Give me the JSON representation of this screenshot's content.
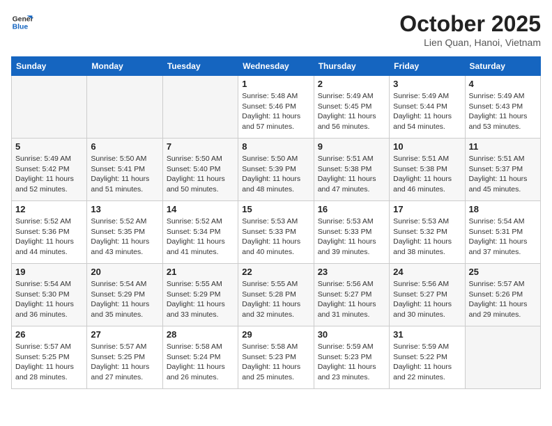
{
  "header": {
    "logo_line1": "General",
    "logo_line2": "Blue",
    "month": "October 2025",
    "location": "Lien Quan, Hanoi, Vietnam"
  },
  "days_of_week": [
    "Sunday",
    "Monday",
    "Tuesday",
    "Wednesday",
    "Thursday",
    "Friday",
    "Saturday"
  ],
  "weeks": [
    [
      {
        "day": "",
        "info": ""
      },
      {
        "day": "",
        "info": ""
      },
      {
        "day": "",
        "info": ""
      },
      {
        "day": "1",
        "info": "Sunrise: 5:48 AM\nSunset: 5:46 PM\nDaylight: 11 hours\nand 57 minutes."
      },
      {
        "day": "2",
        "info": "Sunrise: 5:49 AM\nSunset: 5:45 PM\nDaylight: 11 hours\nand 56 minutes."
      },
      {
        "day": "3",
        "info": "Sunrise: 5:49 AM\nSunset: 5:44 PM\nDaylight: 11 hours\nand 54 minutes."
      },
      {
        "day": "4",
        "info": "Sunrise: 5:49 AM\nSunset: 5:43 PM\nDaylight: 11 hours\nand 53 minutes."
      }
    ],
    [
      {
        "day": "5",
        "info": "Sunrise: 5:49 AM\nSunset: 5:42 PM\nDaylight: 11 hours\nand 52 minutes."
      },
      {
        "day": "6",
        "info": "Sunrise: 5:50 AM\nSunset: 5:41 PM\nDaylight: 11 hours\nand 51 minutes."
      },
      {
        "day": "7",
        "info": "Sunrise: 5:50 AM\nSunset: 5:40 PM\nDaylight: 11 hours\nand 50 minutes."
      },
      {
        "day": "8",
        "info": "Sunrise: 5:50 AM\nSunset: 5:39 PM\nDaylight: 11 hours\nand 48 minutes."
      },
      {
        "day": "9",
        "info": "Sunrise: 5:51 AM\nSunset: 5:38 PM\nDaylight: 11 hours\nand 47 minutes."
      },
      {
        "day": "10",
        "info": "Sunrise: 5:51 AM\nSunset: 5:38 PM\nDaylight: 11 hours\nand 46 minutes."
      },
      {
        "day": "11",
        "info": "Sunrise: 5:51 AM\nSunset: 5:37 PM\nDaylight: 11 hours\nand 45 minutes."
      }
    ],
    [
      {
        "day": "12",
        "info": "Sunrise: 5:52 AM\nSunset: 5:36 PM\nDaylight: 11 hours\nand 44 minutes."
      },
      {
        "day": "13",
        "info": "Sunrise: 5:52 AM\nSunset: 5:35 PM\nDaylight: 11 hours\nand 43 minutes."
      },
      {
        "day": "14",
        "info": "Sunrise: 5:52 AM\nSunset: 5:34 PM\nDaylight: 11 hours\nand 41 minutes."
      },
      {
        "day": "15",
        "info": "Sunrise: 5:53 AM\nSunset: 5:33 PM\nDaylight: 11 hours\nand 40 minutes."
      },
      {
        "day": "16",
        "info": "Sunrise: 5:53 AM\nSunset: 5:33 PM\nDaylight: 11 hours\nand 39 minutes."
      },
      {
        "day": "17",
        "info": "Sunrise: 5:53 AM\nSunset: 5:32 PM\nDaylight: 11 hours\nand 38 minutes."
      },
      {
        "day": "18",
        "info": "Sunrise: 5:54 AM\nSunset: 5:31 PM\nDaylight: 11 hours\nand 37 minutes."
      }
    ],
    [
      {
        "day": "19",
        "info": "Sunrise: 5:54 AM\nSunset: 5:30 PM\nDaylight: 11 hours\nand 36 minutes."
      },
      {
        "day": "20",
        "info": "Sunrise: 5:54 AM\nSunset: 5:29 PM\nDaylight: 11 hours\nand 35 minutes."
      },
      {
        "day": "21",
        "info": "Sunrise: 5:55 AM\nSunset: 5:29 PM\nDaylight: 11 hours\nand 33 minutes."
      },
      {
        "day": "22",
        "info": "Sunrise: 5:55 AM\nSunset: 5:28 PM\nDaylight: 11 hours\nand 32 minutes."
      },
      {
        "day": "23",
        "info": "Sunrise: 5:56 AM\nSunset: 5:27 PM\nDaylight: 11 hours\nand 31 minutes."
      },
      {
        "day": "24",
        "info": "Sunrise: 5:56 AM\nSunset: 5:27 PM\nDaylight: 11 hours\nand 30 minutes."
      },
      {
        "day": "25",
        "info": "Sunrise: 5:57 AM\nSunset: 5:26 PM\nDaylight: 11 hours\nand 29 minutes."
      }
    ],
    [
      {
        "day": "26",
        "info": "Sunrise: 5:57 AM\nSunset: 5:25 PM\nDaylight: 11 hours\nand 28 minutes."
      },
      {
        "day": "27",
        "info": "Sunrise: 5:57 AM\nSunset: 5:25 PM\nDaylight: 11 hours\nand 27 minutes."
      },
      {
        "day": "28",
        "info": "Sunrise: 5:58 AM\nSunset: 5:24 PM\nDaylight: 11 hours\nand 26 minutes."
      },
      {
        "day": "29",
        "info": "Sunrise: 5:58 AM\nSunset: 5:23 PM\nDaylight: 11 hours\nand 25 minutes."
      },
      {
        "day": "30",
        "info": "Sunrise: 5:59 AM\nSunset: 5:23 PM\nDaylight: 11 hours\nand 23 minutes."
      },
      {
        "day": "31",
        "info": "Sunrise: 5:59 AM\nSunset: 5:22 PM\nDaylight: 11 hours\nand 22 minutes."
      },
      {
        "day": "",
        "info": ""
      }
    ]
  ]
}
